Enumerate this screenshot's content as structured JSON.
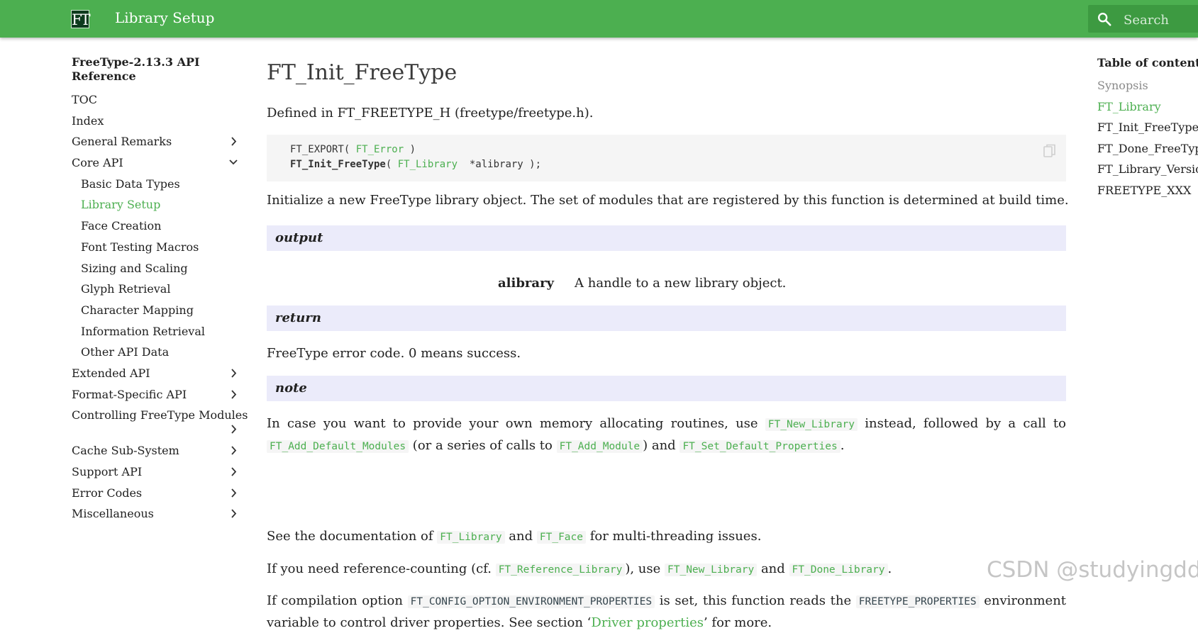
{
  "header": {
    "logo_text": "FT",
    "title": "Library Setup",
    "search_placeholder": "Search",
    "color": "#4caf50"
  },
  "nav": {
    "title": "FreeType-2.13.3 API Reference",
    "items": [
      {
        "label": "TOC"
      },
      {
        "label": "Index"
      },
      {
        "label": "General Remarks",
        "chevron": "right"
      },
      {
        "label": "Core API",
        "chevron": "down"
      },
      {
        "label": "Basic Data Types",
        "sub": true
      },
      {
        "label": "Library Setup",
        "sub": true,
        "active": true
      },
      {
        "label": "Face Creation",
        "sub": true
      },
      {
        "label": "Font Testing Macros",
        "sub": true
      },
      {
        "label": "Sizing and Scaling",
        "sub": true
      },
      {
        "label": "Glyph Retrieval",
        "sub": true
      },
      {
        "label": "Character Mapping",
        "sub": true
      },
      {
        "label": "Information Retrieval",
        "sub": true
      },
      {
        "label": "Other API Data",
        "sub": true
      },
      {
        "label": "Extended API",
        "chevron": "right"
      },
      {
        "label": "Format-Specific API",
        "chevron": "right"
      },
      {
        "label": "Controlling FreeType Modules",
        "chevron": "right"
      },
      {
        "label": "Cache Sub-System",
        "chevron": "right"
      },
      {
        "label": "Support API",
        "chevron": "right"
      },
      {
        "label": "Error Codes",
        "chevron": "right"
      },
      {
        "label": "Miscellaneous",
        "chevron": "right"
      }
    ]
  },
  "main": {
    "heading": "FT_Init_FreeType",
    "defined_in": "Defined in FT_FREETYPE_H (freetype/freetype.h).",
    "code": {
      "line1_prefix": "FT_EXPORT( ",
      "line1_link": "FT_Error",
      "line1_suffix": " )",
      "line2_func": "FT_Init_FreeType",
      "line2_open": "( ",
      "line2_link": "FT_Library",
      "line2_suffix": "  *alibrary );"
    },
    "description": "Initialize a new FreeType library object. The set of modules that are registered by this function is determined at build time.",
    "output_label": "output",
    "output_param": "alibrary",
    "output_desc": "A handle to a new library object.",
    "return_label": "return",
    "return_text": "FreeType error code. 0 means success.",
    "note_label": "note",
    "note1": {
      "t1": "In case you want to provide your own memory allocating routines, use",
      "c1": "FT_New_Library",
      "t2": "instead, followed by a call to",
      "c2": "FT_Add_Default_Modules",
      "t3": "(or a series of calls to",
      "c3": "FT_Add_Module",
      "t4": ") and",
      "c4": "FT_Set_Default_Properties",
      "t5": "."
    },
    "note2": {
      "t1": "See the documentation of",
      "c1": "FT_Library",
      "t2": "and",
      "c2": "FT_Face",
      "t3": "for multi-threading issues."
    },
    "note3": {
      "t1": "If you need reference-counting (cf.",
      "c1": "FT_Reference_Library",
      "t2": "), use",
      "c2": "FT_New_Library",
      "t3": "and",
      "c3": "FT_Done_Library",
      "t4": "."
    },
    "note4": {
      "t1": "If compilation option",
      "c1": "FT_CONFIG_OPTION_ENVIRONMENT_PROPERTIES",
      "t2": "is set, this function reads the",
      "c2": "FREETYPE_PROPERTIES",
      "t3": "environment",
      "t4": "variable to control driver properties. See section ‘",
      "link": "Driver properties",
      "t5": "’ for more."
    }
  },
  "toc": {
    "title": "Table of contents",
    "items": [
      {
        "label": "Synopsis",
        "state": "dim"
      },
      {
        "label": "FT_Library",
        "state": "active"
      },
      {
        "label": "FT_Init_FreeType",
        "state": "normal"
      },
      {
        "label": "FT_Done_FreeType",
        "state": "normal"
      },
      {
        "label": "FT_Library_Version",
        "state": "normal"
      },
      {
        "label": "FREETYPE_XXX",
        "state": "normal"
      }
    ]
  },
  "watermark": "CSDN @studyingdda"
}
